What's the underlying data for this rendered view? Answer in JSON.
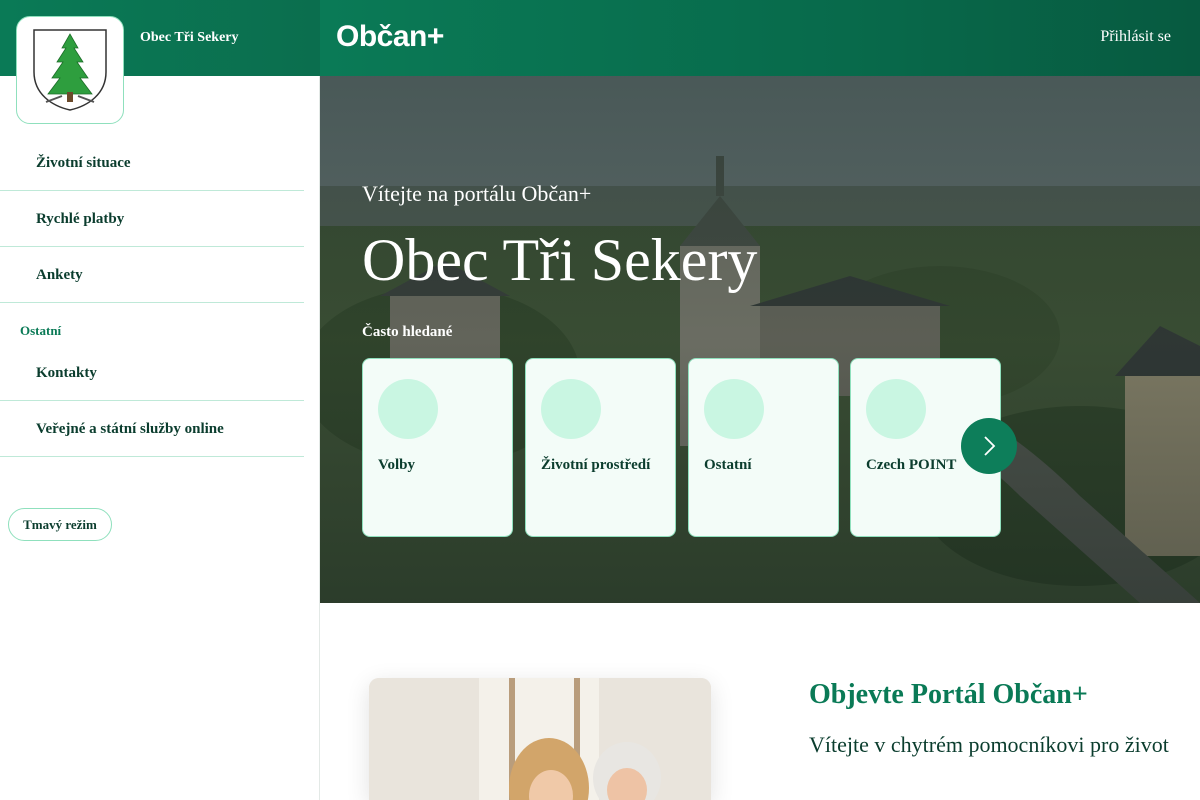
{
  "sidebar": {
    "municipality_name": "Obec Tři Sekery",
    "logo_icon": "coat-of-arms-spruce-icon",
    "nav_items": [
      {
        "label": "Životní situace"
      },
      {
        "label": "Rychlé platby"
      },
      {
        "label": "Ankety"
      }
    ],
    "section_label": "Ostatní",
    "section_items": [
      {
        "label": "Kontakty"
      },
      {
        "label": "Veřejné a státní služby online"
      }
    ],
    "dark_mode_label": "Tmavý režim"
  },
  "header": {
    "brand": "Občan+",
    "login_label": "Přihlásit se"
  },
  "hero": {
    "welcome": "Vítejte na portálu Občan+",
    "title": "Obec Tři Sekery",
    "often_searched_label": "Často hledané",
    "cards": [
      {
        "label": "Volby"
      },
      {
        "label": "Životní prostředí"
      },
      {
        "label": "Ostatní"
      },
      {
        "label": "Czech POINT"
      }
    ],
    "next_icon": "chevron-right-icon"
  },
  "discover": {
    "title": "Objevte Portál Občan+",
    "subtitle": "Vítejte v chytrém pomocníkovi pro život"
  },
  "colors": {
    "brand_green": "#0a7a56",
    "accent_mint": "#8fe0bd",
    "text_dark": "#0b3d2e"
  }
}
